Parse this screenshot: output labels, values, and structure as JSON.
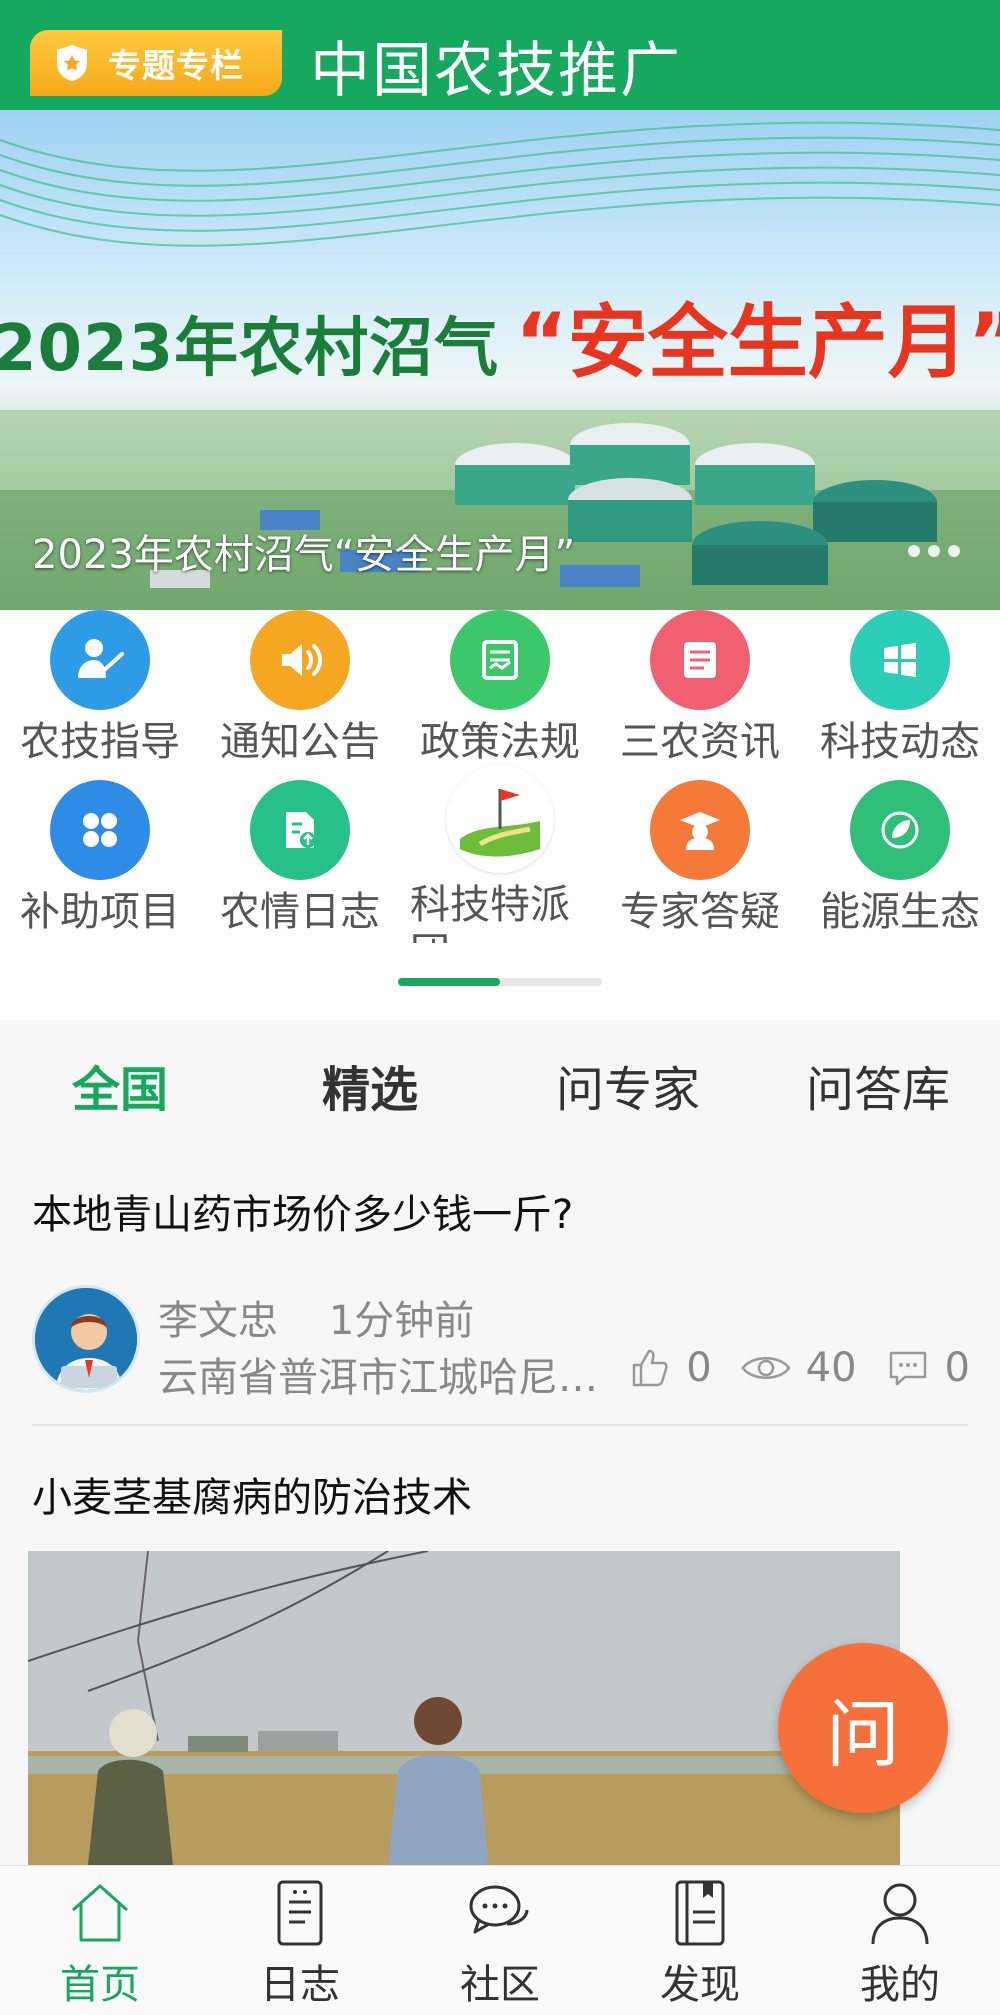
{
  "header": {
    "badge_label": "专题专栏",
    "title": "中国农技推广",
    "color": "#16a85f"
  },
  "banner": {
    "headline_green": "2023年农村沼气",
    "headline_red": "“安全生产月”",
    "caption": "2023年农村沼气“安全生产月”",
    "dots": 3
  },
  "categories": [
    {
      "label": "农技指导",
      "icon": "teacher-icon",
      "color": "#2e9be6"
    },
    {
      "label": "通知公告",
      "icon": "speaker-icon",
      "color": "#f5a623"
    },
    {
      "label": "政策法规",
      "icon": "document-chart-icon",
      "color": "#3cc86a"
    },
    {
      "label": "三农资讯",
      "icon": "news-list-icon",
      "color": "#f06071"
    },
    {
      "label": "科技动态",
      "icon": "windows-icon",
      "color": "#2ccdb6"
    },
    {
      "label": "补助项目",
      "icon": "grid-icon",
      "color": "#2e8be6"
    },
    {
      "label": "农情日志",
      "icon": "upload-doc-icon",
      "color": "#26c08a"
    },
    {
      "label": "科技特派团",
      "icon": "flag-field-icon",
      "color": "#ffffff"
    },
    {
      "label": "专家答疑",
      "icon": "graduate-icon",
      "color": "#f57a3a"
    },
    {
      "label": "能源生态",
      "icon": "leaf-recycle-icon",
      "color": "#2fbf78"
    }
  ],
  "category_page_progress": 0.5,
  "tabs": [
    "全国",
    "精选",
    "问专家",
    "问答库"
  ],
  "active_tab": "全国",
  "feed": [
    {
      "title": "本地青山药市场价多少钱一斤?",
      "author": "李文忠",
      "time": "1分钟前",
      "location": "云南省普洱市江城哈尼族彝族自治县",
      "likes": "0",
      "views": "40",
      "comments": "0"
    },
    {
      "title": "小麦茎基腐病的防治技术"
    }
  ],
  "fab_label": "问",
  "nav": [
    {
      "label": "首页",
      "icon": "home-icon",
      "active": true
    },
    {
      "label": "日志",
      "icon": "notebook-icon",
      "active": false
    },
    {
      "label": "社区",
      "icon": "chat-bubbles-icon",
      "active": false
    },
    {
      "label": "发现",
      "icon": "book-icon",
      "active": false
    },
    {
      "label": "我的",
      "icon": "user-icon",
      "active": false
    }
  ]
}
